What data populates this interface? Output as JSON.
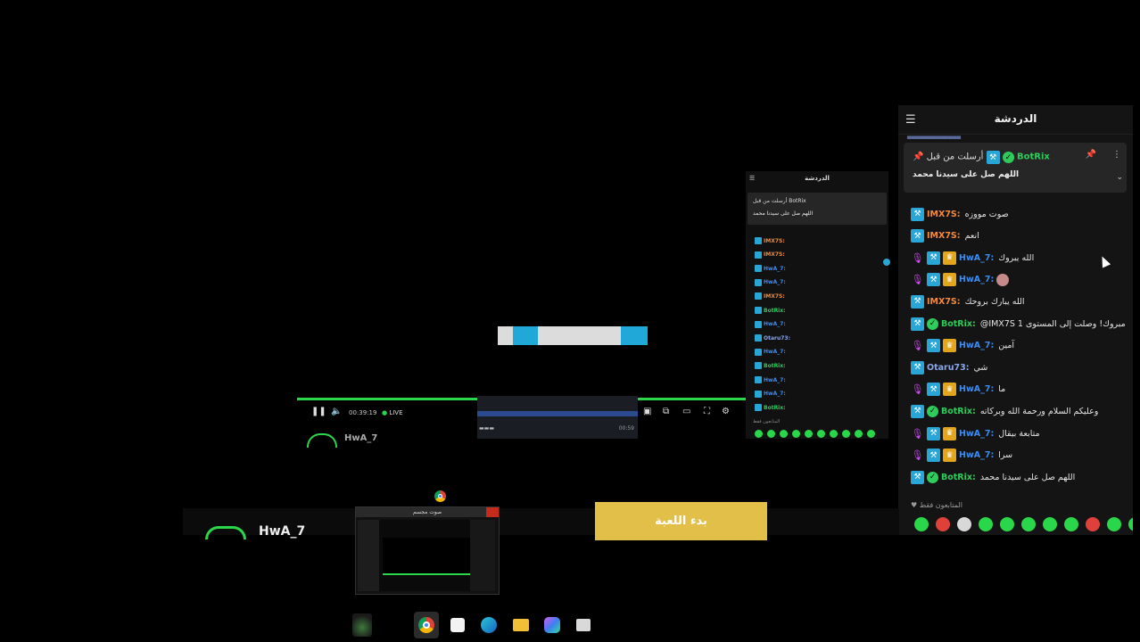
{
  "chat": {
    "title": "الدردشة",
    "menu_icon": "menu-icon",
    "pinned": {
      "by_label": "أرسلت من قبل",
      "user": "BotRix",
      "message": "اللهم صل على سيدنا محمد"
    },
    "messages": [
      {
        "user": "IMX7S:",
        "text": "صوت مووزه",
        "color": "#f28b3c",
        "badges": [
          "tool"
        ]
      },
      {
        "user": "IMX7S:",
        "text": "انعم",
        "color": "#f28b3c",
        "badges": [
          "tool"
        ]
      },
      {
        "user": "HwA_7:",
        "text": "الله يبروك",
        "color": "#3d8cf0",
        "badges": [
          "mic",
          "tool",
          "crown"
        ]
      },
      {
        "user": "HwA_7:",
        "text": "",
        "color": "#3d8cf0",
        "badges": [
          "mic",
          "tool",
          "crown"
        ],
        "emote": true
      },
      {
        "user": "IMX7S:",
        "text": "الله يبارك بروحك",
        "color": "#f28b3c",
        "badges": [
          "tool"
        ]
      },
      {
        "user": "BotRix:",
        "text": "@IMX7S 1 مبروك! وصلت إلى المستوى",
        "color": "#2ecc5b",
        "badges": [
          "tool",
          "check"
        ]
      },
      {
        "user": "HwA_7:",
        "text": "آمين",
        "color": "#3d8cf0",
        "badges": [
          "mic",
          "tool",
          "crown"
        ]
      },
      {
        "user": "Otaru73:",
        "text": "شي",
        "color": "#8aa6e8",
        "badges": [
          "tool"
        ]
      },
      {
        "user": "HwA_7:",
        "text": "ما",
        "color": "#3d8cf0",
        "badges": [
          "mic",
          "tool",
          "crown"
        ]
      },
      {
        "user": "BotRix:",
        "text": "وعليكم السلام ورحمة الله وبركاته",
        "color": "#2ecc5b",
        "badges": [
          "tool",
          "check"
        ]
      },
      {
        "user": "HwA_7:",
        "text": "متابعة بيقال",
        "color": "#3d8cf0",
        "badges": [
          "mic",
          "tool",
          "crown"
        ]
      },
      {
        "user": "HwA_7:",
        "text": "سرا",
        "color": "#3d8cf0",
        "badges": [
          "mic",
          "tool",
          "crown"
        ]
      },
      {
        "user": "BotRix:",
        "text": "اللهم صل على سيدنا محمد",
        "color": "#2ecc5b",
        "badges": [
          "tool",
          "check"
        ]
      }
    ],
    "footer_note": "المتابعون فقط",
    "emote_colors": [
      "#2bd74a",
      "#e0403a",
      "#d8d8d8",
      "#2bd74a",
      "#2bd74a",
      "#2bd74a",
      "#2bd74a",
      "#2bd74a",
      "#e0403a",
      "#2bd74a",
      "#2bd74a"
    ]
  },
  "mini_chat": {
    "title": "الدردشة",
    "pinned_by": "أرسلت من قبل BotRix",
    "pinned_message": "اللهم صل على سيدنا محمد",
    "rows": [
      {
        "user": "IMX7S:",
        "color": "#f28b3c"
      },
      {
        "user": "IMX7S:",
        "color": "#f28b3c"
      },
      {
        "user": "HwA_7:",
        "color": "#3d8cf0"
      },
      {
        "user": "HwA_7:",
        "color": "#3d8cf0"
      },
      {
        "user": "IMX7S:",
        "color": "#f28b3c"
      },
      {
        "user": "BotRix:",
        "color": "#2ecc5b"
      },
      {
        "user": "HwA_7:",
        "color": "#3d8cf0"
      },
      {
        "user": "Otaru73:",
        "color": "#8aa6e8"
      },
      {
        "user": "HwA_7:",
        "color": "#3d8cf0"
      },
      {
        "user": "BotRix:",
        "color": "#2ecc5b"
      },
      {
        "user": "HwA_7:",
        "color": "#3d8cf0"
      },
      {
        "user": "HwA_7:",
        "color": "#3d8cf0"
      },
      {
        "user": "BotRix:",
        "color": "#2ecc5b"
      }
    ],
    "footer": "المتابعون فقط"
  },
  "player": {
    "time": "00:39:19",
    "live_label": "LIVE",
    "channel": "HwA_7",
    "timeline_label": "00:59"
  },
  "bottom": {
    "channel": "HwA_7",
    "start_button": "بدء اللعبة"
  },
  "thumbnail": {
    "title": "صوت مجسم"
  },
  "colors": {
    "accent_green": "#2bd74a",
    "button_gold": "#e2bf49",
    "loading_blue": "#1fa8d8"
  }
}
